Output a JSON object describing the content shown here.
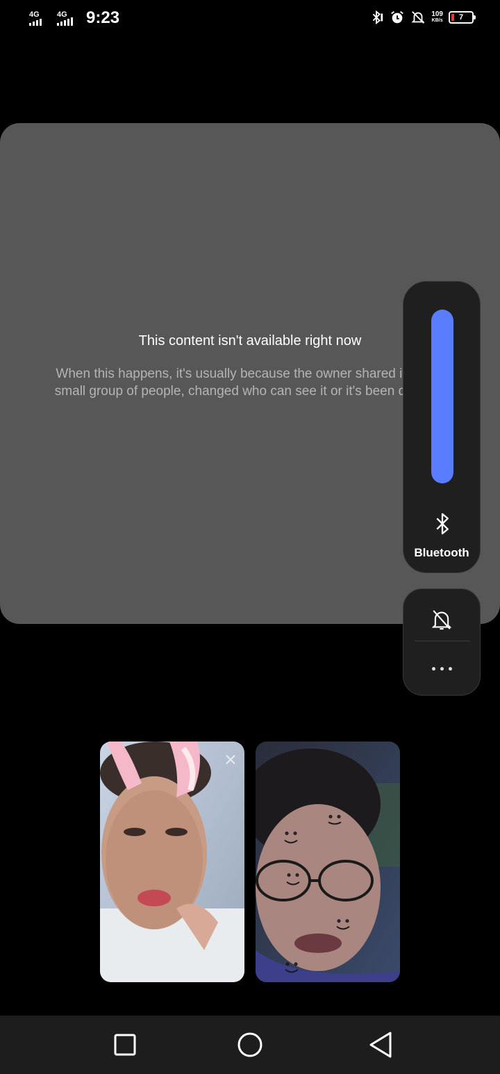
{
  "status_bar": {
    "network_1": "4G",
    "network_2": "4G",
    "time": "9:23",
    "speed_value": "109",
    "speed_unit": "KB/s",
    "battery_level": "7",
    "icons": [
      "bluetooth-icon",
      "alarm-icon",
      "silent-icon",
      "battery-icon"
    ]
  },
  "content_card": {
    "title": "This content isn't available right now",
    "body": "When this happens, it's usually because the owner shared it with a small group of people, changed who can see it or it's been deleted."
  },
  "volume_panel": {
    "level": 1.0,
    "accent_color": "#5a7cff",
    "output_label": "Bluetooth",
    "output_icon": "bluetooth-icon"
  },
  "controls": {
    "mute_icon": "bell-off-icon",
    "more_icon": "more-horizontal-icon"
  },
  "video_tiles": [
    {
      "name": "participant-1",
      "muted": true
    },
    {
      "name": "participant-2",
      "muted": false
    }
  ],
  "nav_bar": {
    "buttons": [
      "recents-button",
      "home-button",
      "back-button"
    ]
  }
}
